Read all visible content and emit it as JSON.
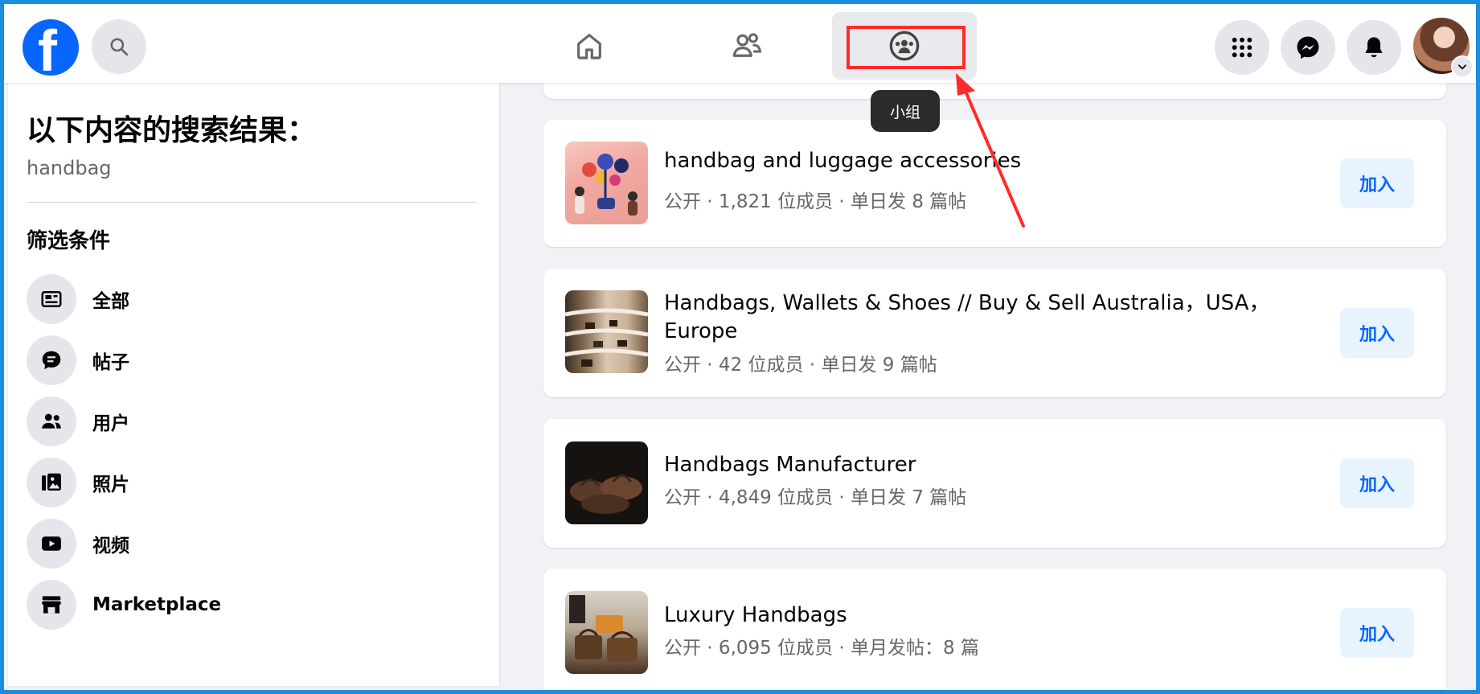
{
  "topbar": {
    "logo_letter": "f",
    "nav": {
      "groups_tooltip": "小组"
    },
    "icons": [
      "facebook-logo",
      "search-icon",
      "home-icon",
      "friends-icon",
      "groups-icon",
      "menu-grid-icon",
      "messenger-icon",
      "bell-icon",
      "avatar"
    ],
    "accent_color": "#0866ff",
    "highlight_color": "#ff2a2a"
  },
  "sidebar": {
    "title": "以下内容的搜索结果：",
    "query": "handbag",
    "filters_heading": "筛选条件",
    "items": [
      {
        "label": "全部",
        "icon": "feed-icon"
      },
      {
        "label": "帖子",
        "icon": "post-icon"
      },
      {
        "label": "用户",
        "icon": "people-icon"
      },
      {
        "label": "照片",
        "icon": "photo-icon"
      },
      {
        "label": "视频",
        "icon": "video-icon"
      },
      {
        "label": "Marketplace",
        "icon": "store-icon"
      }
    ]
  },
  "results": [
    {
      "name": "handbag and luggage accessories",
      "meta": "公开 · 1,821 位成员 · 单日发 8 篇帖",
      "join": "加入"
    },
    {
      "name": "Handbags, Wallets & Shoes // Buy & Sell Australia，USA，Europe",
      "meta": "公开 · 42 位成员 · 单日发 9 篇帖",
      "join": "加入"
    },
    {
      "name": "Handbags Manufacturer",
      "meta": "公开 · 4,849 位成员 · 单日发 7 篇帖",
      "join": "加入"
    },
    {
      "name": "Luxury Handbags",
      "meta": "公开 · 6,095 位成员 · 单月发帖：8 篇",
      "join": "加入"
    }
  ]
}
